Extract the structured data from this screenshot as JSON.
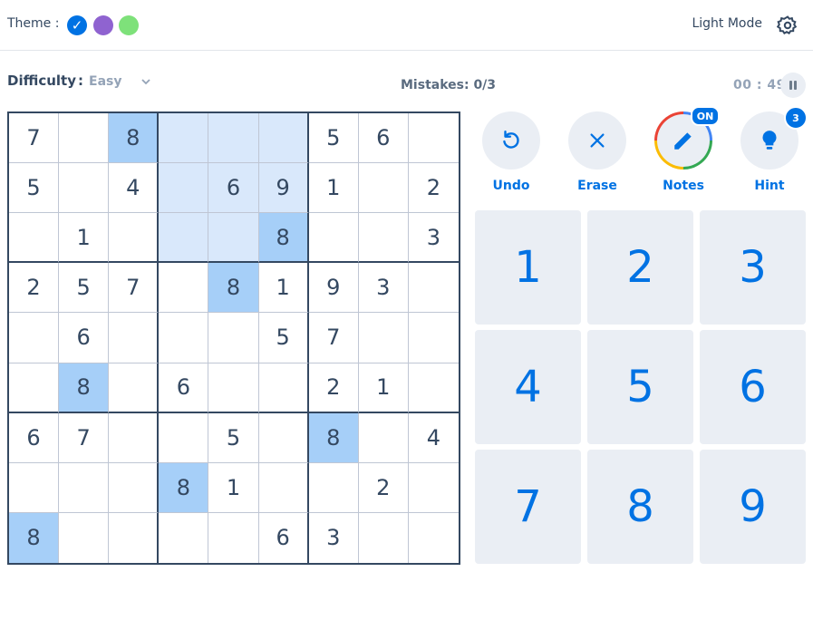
{
  "header": {
    "theme_label": "Theme :",
    "themes": [
      {
        "name": "blue",
        "color": "#0072e3",
        "selected": true
      },
      {
        "name": "purple",
        "color": "#8f63d0",
        "selected": false
      },
      {
        "name": "green",
        "color": "#7ee17a",
        "selected": false
      }
    ],
    "mode_label": "Light Mode",
    "settings_icon": "gear-icon"
  },
  "status": {
    "difficulty_label": "Difficulty",
    "difficulty_sep": ":",
    "difficulty_value": "Easy",
    "mistakes": "Mistakes: 0/3",
    "timer": "00 : 49"
  },
  "board": {
    "cells": [
      [
        "7",
        "",
        "8",
        "",
        "",
        "",
        "5",
        "6",
        ""
      ],
      [
        "5",
        "",
        "4",
        "",
        "6",
        "9",
        "1",
        "",
        "2"
      ],
      [
        "",
        "1",
        "",
        "",
        "",
        "8",
        "",
        "",
        "3"
      ],
      [
        "2",
        "5",
        "7",
        "",
        "8",
        "1",
        "9",
        "3",
        ""
      ],
      [
        "",
        "6",
        "",
        "",
        "",
        "5",
        "7",
        "",
        ""
      ],
      [
        "",
        "8",
        "",
        "6",
        "",
        "",
        "2",
        "1",
        ""
      ],
      [
        "6",
        "7",
        "",
        "",
        "5",
        "",
        "8",
        "",
        "4"
      ],
      [
        "",
        "",
        "",
        "8",
        "1",
        "",
        "",
        "2",
        ""
      ],
      [
        "8",
        "",
        "",
        "",
        "",
        "6",
        "3",
        "",
        ""
      ]
    ],
    "highlight_box": [
      [
        0,
        3
      ],
      [
        0,
        4
      ],
      [
        0,
        5
      ],
      [
        1,
        3
      ],
      [
        1,
        4
      ],
      [
        1,
        5
      ],
      [
        2,
        3
      ],
      [
        2,
        4
      ]
    ],
    "highlight_same": [
      [
        0,
        2
      ],
      [
        2,
        5
      ],
      [
        3,
        4
      ],
      [
        5,
        1
      ],
      [
        6,
        6
      ],
      [
        7,
        3
      ],
      [
        8,
        0
      ]
    ],
    "colors": {
      "box": "#d9e8fb",
      "same": "#a6cff8",
      "lines": "#344861"
    }
  },
  "actions": {
    "undo": {
      "label": "Undo",
      "icon": "undo-icon"
    },
    "erase": {
      "label": "Erase",
      "icon": "close-icon"
    },
    "notes": {
      "label": "Notes",
      "icon": "pencil-icon",
      "badge": "ON"
    },
    "hint": {
      "label": "Hint",
      "icon": "lightbulb-icon",
      "badge": "3"
    }
  },
  "numpad": [
    "1",
    "2",
    "3",
    "4",
    "5",
    "6",
    "7",
    "8",
    "9"
  ],
  "accent_color": "#0072e3"
}
